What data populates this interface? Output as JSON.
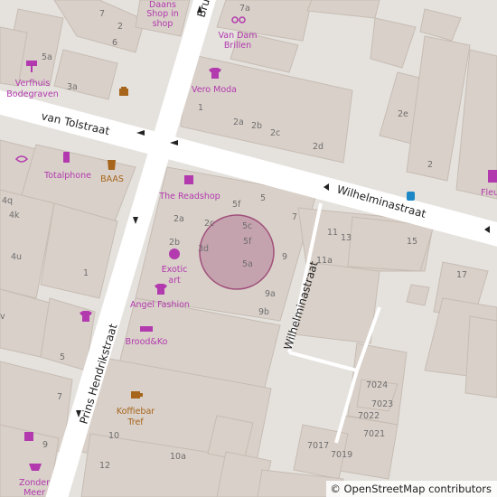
{
  "map": {
    "streets": {
      "van_tolstraat": "van Tolstraat",
      "wilhelminastraat_main": "Wilhelminastraat",
      "wilhelminastraat_side": "Wilhelminastraat",
      "prins_hendrikstraat": "Prins Hendrikstraat",
      "bru": "Bru"
    },
    "pois": {
      "daans_shop": [
        "Daans",
        "Shop in",
        "shop"
      ],
      "van_dam_brillen": [
        "Van Dam",
        "Brillen"
      ],
      "vero_moda": "Vero Moda",
      "verfhuis": [
        "Verfhuis",
        "Bodegraven"
      ],
      "totalphone": "Totalphone",
      "baas": "BAAS",
      "the_readshop": "The Readshop",
      "exotic_art": [
        "Exotic",
        "art"
      ],
      "angel_fashion": "Angel Fashion",
      "brood_ko": "Brood&Ko",
      "koffiebar": [
        "Koffiebar",
        "Tref"
      ],
      "zonder_meer": [
        "Zonder",
        "Meer"
      ],
      "fleu": "Fleu"
    },
    "house_numbers": {
      "n7_top": "7",
      "n2_top": "2",
      "n6_top": "6",
      "n5a_left": "5a",
      "n3a": "3a",
      "n7a": "7a",
      "n1_vero": "1",
      "n2a": "2a",
      "n2b_top": "2b",
      "n2c": "2c",
      "n2d": "2d",
      "n2e": "2e",
      "n2_right": "2",
      "n4q": "4q",
      "n4k": "4k",
      "n4u": "4u",
      "n1_left": "1",
      "n5_left": "5",
      "nv": "v",
      "n2a_mid": "2a",
      "n2b_mid": "2b",
      "n2c_mid": "2c",
      "n3d": "3d",
      "n5f_top": "5f",
      "n5_mid": "5",
      "n5c": "5c",
      "n5f": "5f",
      "n5a_mid": "5a",
      "n7_mid": "7",
      "n9": "9",
      "n9a": "9a",
      "n9b": "9b",
      "n11": "11",
      "n13": "13",
      "n15": "15",
      "n11a": "11a",
      "n17": "17",
      "n7_low": "7",
      "n9_low": "9",
      "n10": "10",
      "n10a": "10a",
      "n12": "12",
      "n7024": "7024",
      "n7023": "7023",
      "n7022": "7022",
      "n7021": "7021",
      "n7017": "7017",
      "n7019": "7019"
    },
    "marker_color": "#a0507a",
    "poi_color": "#b23aae",
    "shop_brown": "#a6651b",
    "road_color": "#ffffff",
    "building_color": "#d9d0c9"
  },
  "attribution": {
    "symbol": "©",
    "text": "OpenStreetMap contributors"
  }
}
